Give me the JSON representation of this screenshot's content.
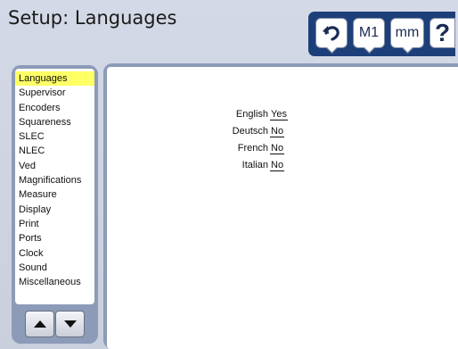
{
  "screen": {
    "title": "Setup: Languages"
  },
  "toolbar": {
    "undo_icon": "undo-arrow-icon",
    "m1_label": "M1",
    "mm_label": "mm",
    "help_label": "?"
  },
  "menu": {
    "items": [
      {
        "label": "Languages",
        "selected": true
      },
      {
        "label": "Supervisor"
      },
      {
        "label": "Encoders"
      },
      {
        "label": "Squareness"
      },
      {
        "label": "SLEC"
      },
      {
        "label": "NLEC"
      },
      {
        "label": "Ved"
      },
      {
        "label": "Magnifications"
      },
      {
        "label": "Measure"
      },
      {
        "label": "Display"
      },
      {
        "label": "Print"
      },
      {
        "label": "Ports"
      },
      {
        "label": "Clock"
      },
      {
        "label": "Sound"
      },
      {
        "label": "Miscellaneous"
      }
    ],
    "up_icon": "arrow-up-icon",
    "down_icon": "arrow-down-icon"
  },
  "languages": [
    {
      "label": "English",
      "value": "Yes"
    },
    {
      "label": "Deutsch",
      "value": "No"
    },
    {
      "label": "French",
      "value": "No"
    },
    {
      "label": "Italian",
      "value": "No"
    }
  ],
  "colors": {
    "selection": "#ffff66",
    "toolbar": "#1c3f7a",
    "panel": "#8c9bb7"
  }
}
